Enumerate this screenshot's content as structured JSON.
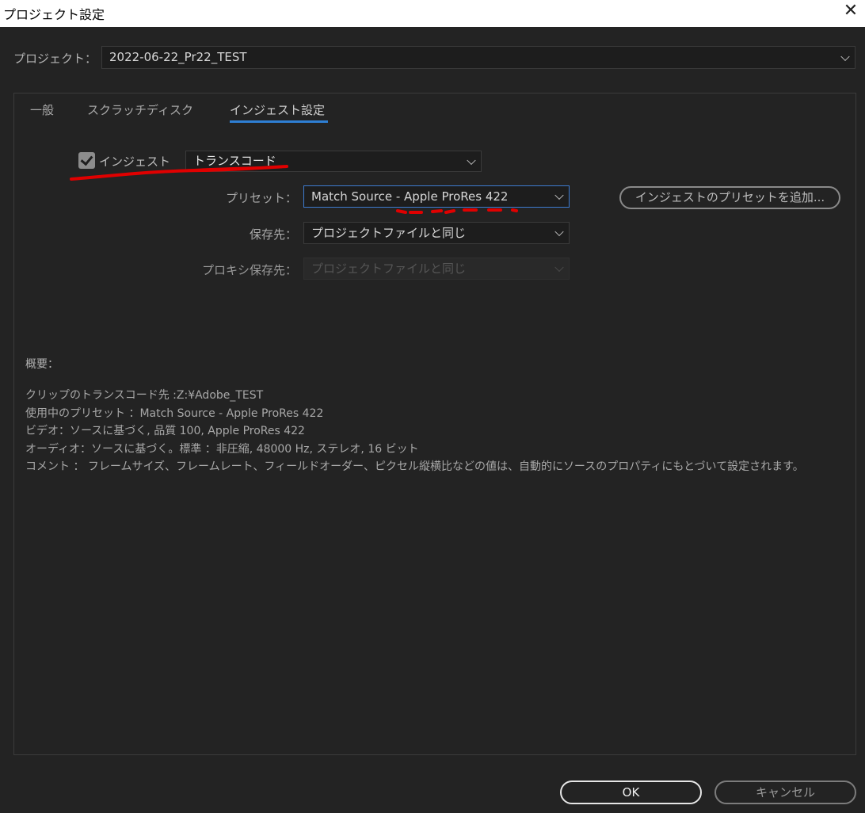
{
  "window": {
    "title": "プロジェクト設定",
    "close_glyph": "✕"
  },
  "project": {
    "label": "プロジェクト：",
    "value": "2022-06-22_Pr22_TEST"
  },
  "tabs": [
    {
      "label": "一般",
      "active": false
    },
    {
      "label": "スクラッチディスク",
      "active": false
    },
    {
      "label": "インジェスト設定",
      "active": true
    }
  ],
  "ingest": {
    "checkbox_label": "インジェスト",
    "checked": true,
    "mode_value": "トランスコード",
    "preset_label": "プリセット：",
    "preset_value": "Match Source - Apple ProRes 422",
    "add_preset_button": "インジェストのプリセットを追加...",
    "destination_label": "保存先：",
    "destination_value": "プロジェクトファイルと同じ",
    "proxy_destination_label": "プロキシ保存先：",
    "proxy_destination_value": "プロジェクトファイルと同じ"
  },
  "summary": {
    "title": "概要：",
    "lines": [
      "クリップのトランスコード先 :Z:¥Adobe_TEST",
      "使用中のプリセット ：Match Source - Apple ProRes 422",
      "ビデオ：ソースに基づく, 品質 100, Apple ProRes 422",
      "オーディオ：ソースに基づく。標準 ：非圧縮, 48000 Hz, ステレオ, 16 ビット",
      "コメント ： フレームサイズ、フレームレート、フィールドオーダー、ピクセル縦横比などの値は、自動的にソースのプロパティにもとづいて設定されます。"
    ]
  },
  "buttons": {
    "ok": "OK",
    "cancel": "キャンセル"
  },
  "colors": {
    "annotation": "#e00000",
    "accent": "#2e7fd4",
    "background": "#232323"
  }
}
